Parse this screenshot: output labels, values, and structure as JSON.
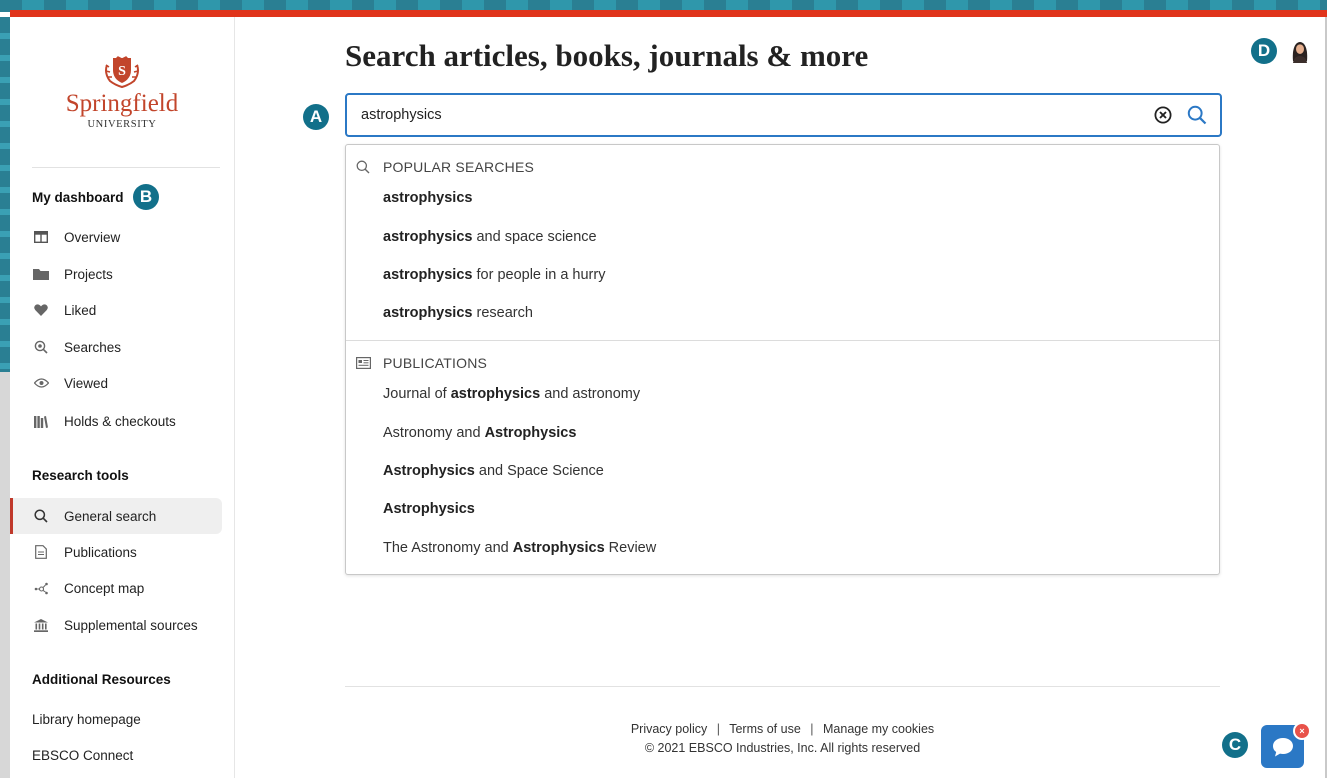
{
  "brand": {
    "name": "Springfield",
    "subtitle": "UNIVERSITY",
    "color": "#c2452b"
  },
  "sidebar": {
    "dashboard_title": "My dashboard",
    "dashboard_items": [
      {
        "label": "Overview",
        "icon": "overview-icon"
      },
      {
        "label": "Projects",
        "icon": "folder-icon"
      },
      {
        "label": "Liked",
        "icon": "heart-icon"
      },
      {
        "label": "Searches",
        "icon": "saved-search-icon"
      },
      {
        "label": "Viewed",
        "icon": "eye-icon"
      },
      {
        "label": "Holds & checkouts",
        "icon": "books-icon"
      }
    ],
    "research_title": "Research tools",
    "research_items": [
      {
        "label": "General search",
        "icon": "search-icon",
        "active": true
      },
      {
        "label": "Publications",
        "icon": "document-icon"
      },
      {
        "label": "Concept map",
        "icon": "concept-map-icon"
      },
      {
        "label": "Supplemental sources",
        "icon": "institution-icon"
      }
    ],
    "additional_title": "Additional Resources",
    "additional_links": [
      "Library homepage",
      "EBSCO Connect"
    ]
  },
  "main": {
    "title": "Search articles, books, journals & more",
    "search": {
      "value": "astrophysics",
      "placeholder": ""
    }
  },
  "dropdown": {
    "popular_header": "POPULAR SEARCHES",
    "popular": [
      {
        "bold": "astrophysics",
        "rest": ""
      },
      {
        "bold": "astrophysics",
        "rest": " and space science"
      },
      {
        "bold": "astrophysics",
        "rest": " for people in a hurry"
      },
      {
        "bold": "astrophysics",
        "rest": " research"
      }
    ],
    "publications_header": "PUBLICATIONS",
    "publications": [
      {
        "pre": "Journal of ",
        "bold": "astrophysics",
        "post": " and astronomy"
      },
      {
        "pre": "Astronomy and ",
        "bold": "Astrophysics",
        "post": ""
      },
      {
        "pre": "",
        "bold": "Astrophysics",
        "post": " and Space Science"
      },
      {
        "pre": "",
        "bold": "Astrophysics",
        "post": ""
      },
      {
        "pre": "The Astronomy and ",
        "bold": "Astrophysics",
        "post": " Review"
      }
    ]
  },
  "footer": {
    "privacy": "Privacy policy",
    "terms": "Terms of use",
    "cookies": "Manage my cookies",
    "separator": "|",
    "copyright": "© 2021 EBSCO Industries, Inc. All rights reserved"
  },
  "markers": {
    "a": "A",
    "b": "B",
    "c": "C",
    "d": "D"
  },
  "chat": {
    "badge": "×"
  },
  "colors": {
    "accent_blue": "#2b78c5",
    "marker_teal": "#12708a",
    "top_bar_red": "#e0341b",
    "active_indicator": "#c0392b"
  }
}
